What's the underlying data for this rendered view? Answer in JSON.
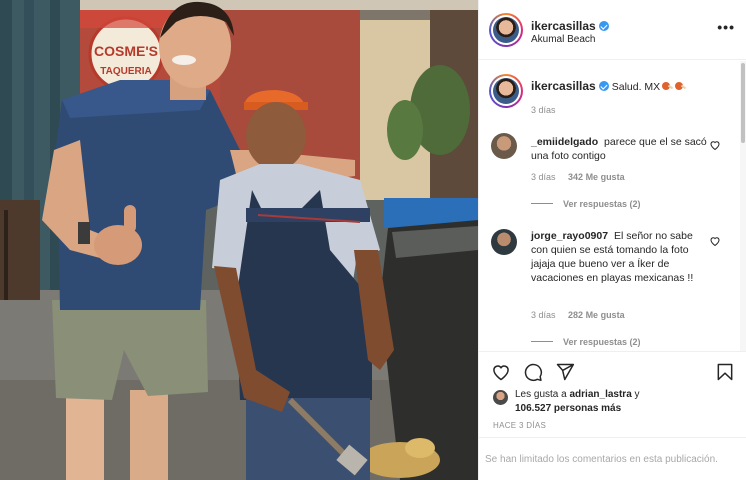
{
  "post": {
    "username": "ikercasillas",
    "location": "Akumal Beach",
    "caption_text": "Salud. MX",
    "caption_time": "3 días",
    "photo_sign": {
      "line1": "COSME'S",
      "line2": "TAQUERIA"
    }
  },
  "comments": [
    {
      "username": "_emiidelgado",
      "text": "parece que el se sacó una foto contigo",
      "time": "3 días",
      "likes": "342 Me gusta",
      "replies": "Ver respuestas (2)"
    },
    {
      "username": "jorge_rayo0907",
      "text": "El señor no sabe con quien se está tomando la foto jajaja que bueno ver a Íker de vacaciones en playas mexicanas !!",
      "time": "3 días",
      "likes": "282 Me gusta",
      "replies": "Ver respuestas (2)"
    }
  ],
  "likes": {
    "prefix": "Les gusta a",
    "first_user": "adrian_lastra",
    "connector": "y",
    "count": "106.527 personas más"
  },
  "date": "HACE 3 DÍAS",
  "comments_limited": "Se han limitado los comentarios en esta publicación.",
  "icons": [
    "heart-icon",
    "comment-icon",
    "share-icon",
    "bookmark-icon",
    "more-icon",
    "verified-badge-icon"
  ],
  "colors": {
    "verified": "#3897f0",
    "secondary_text": "#8e8e8e",
    "border": "#efefef"
  }
}
